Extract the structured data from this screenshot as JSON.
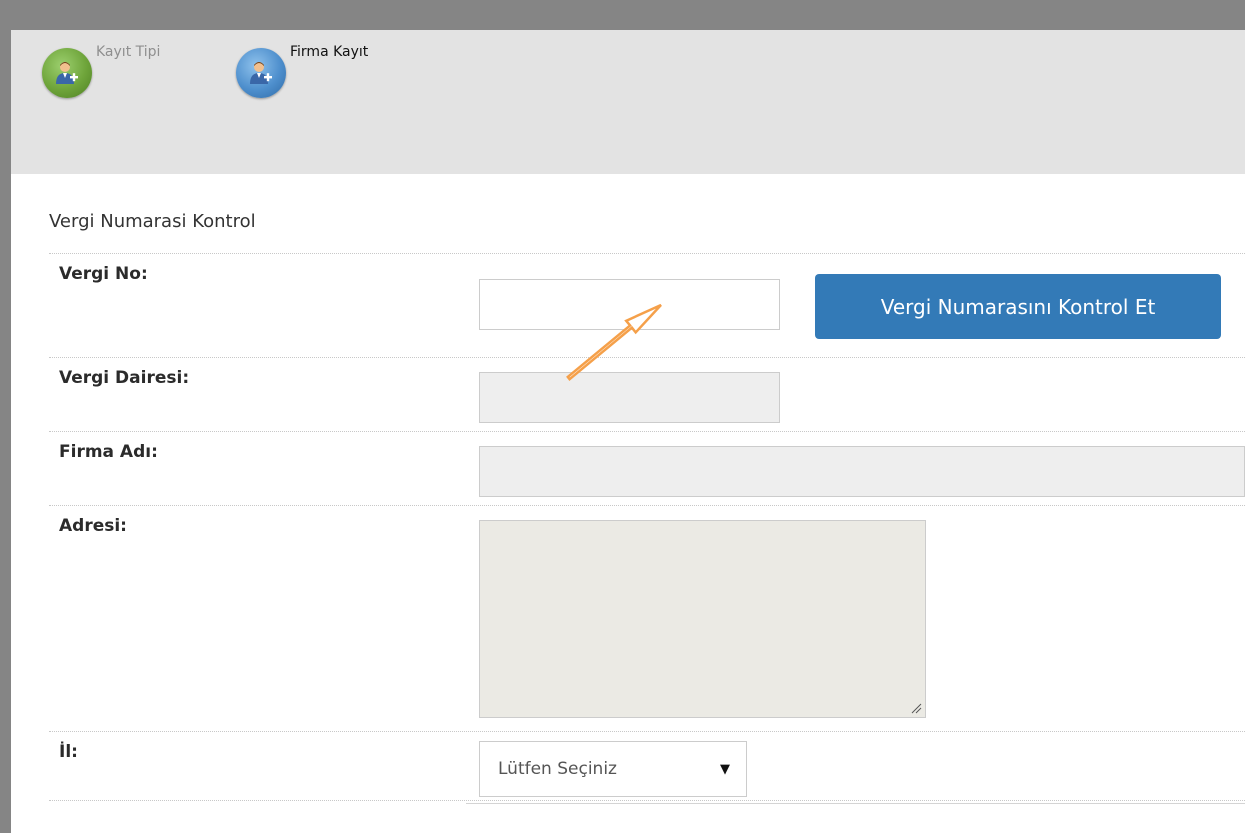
{
  "steps": [
    {
      "label": "Kayıt Tipi",
      "icon": "add-user-icon",
      "color": "green",
      "state": "completed"
    },
    {
      "label": "Firma Kayıt",
      "icon": "add-user-icon",
      "color": "blue",
      "state": "active"
    }
  ],
  "section_title": "Vergi Numarasi Kontrol",
  "fields": {
    "vergi_no": {
      "label": "Vergi No:",
      "value": ""
    },
    "check_button": {
      "label": "Vergi Numarasını Kontrol Et"
    },
    "vergi_dairesi": {
      "label": "Vergi Dairesi:",
      "value": ""
    },
    "firma_adi": {
      "label": "Firma Adı:",
      "value": ""
    },
    "adresi": {
      "label": "Adresi:",
      "value": ""
    },
    "il": {
      "label": "İl:",
      "selected": "Lütfen Seçiniz"
    }
  },
  "colors": {
    "frame": "#858585",
    "header_background": "#e3e3e3",
    "primary_button": "#337ab7",
    "annotation_arrow": "#f5a04a",
    "step_green": "#6ea43a",
    "step_blue": "#4e8fcd"
  },
  "annotation": {
    "icon": "arrow-up-right-icon"
  }
}
